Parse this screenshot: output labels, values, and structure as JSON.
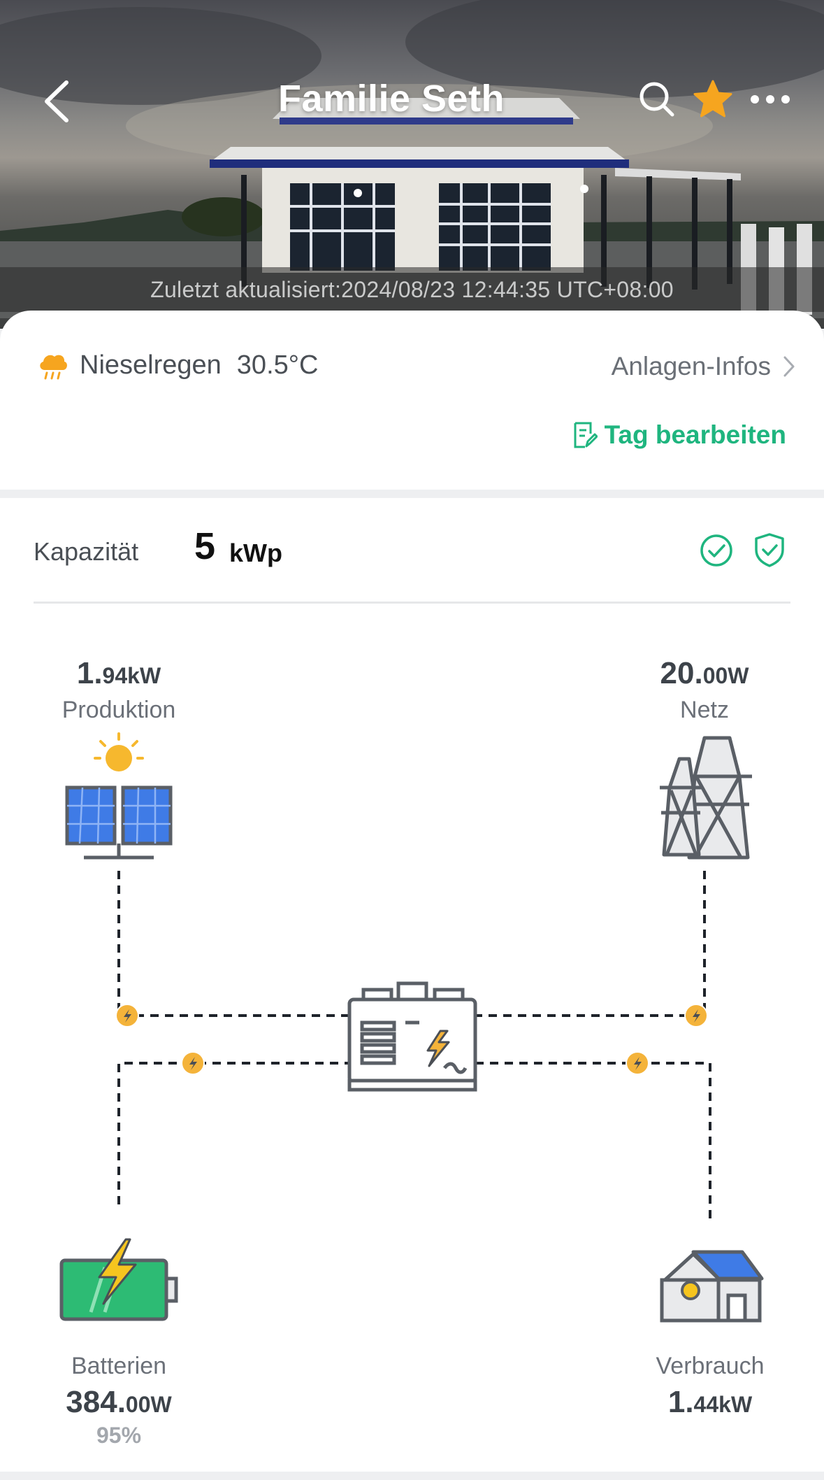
{
  "header": {
    "title": "Familie Seth",
    "back_icon": "chevron-left-icon",
    "search_icon": "search-icon",
    "favorite_icon": "star-icon",
    "more_icon": "more-dots-icon",
    "last_updated": "Zuletzt aktualisiert:2024/08/23 12:44:35 UTC+08:00"
  },
  "info": {
    "weather_icon": "cloud-rain-icon",
    "weather": "Nieselregen",
    "temperature": "30.5°C",
    "plant_info_label": "Anlagen-Infos",
    "edit_tag_label": "Tag bearbeiten"
  },
  "capacity": {
    "label": "Kapazität",
    "value": "5",
    "unit": "kWp"
  },
  "flow": {
    "production": {
      "value_int": "1.",
      "value_dec": "94kW",
      "label": "Produktion"
    },
    "grid": {
      "value_int": "20.",
      "value_dec": "00W",
      "label": "Netz"
    },
    "battery": {
      "label": "Batterien",
      "value_int": "384.",
      "value_dec": "00W",
      "soc": "95%"
    },
    "consumption": {
      "label": "Verbrauch",
      "value_int": "1.",
      "value_dec": "44kW"
    }
  },
  "colors": {
    "accent_green": "#1fb57f",
    "star_orange": "#f6a51f",
    "flow_dot": "#f4b33a",
    "battery_green": "#2dbb74",
    "panel_blue": "#3f7be6"
  }
}
